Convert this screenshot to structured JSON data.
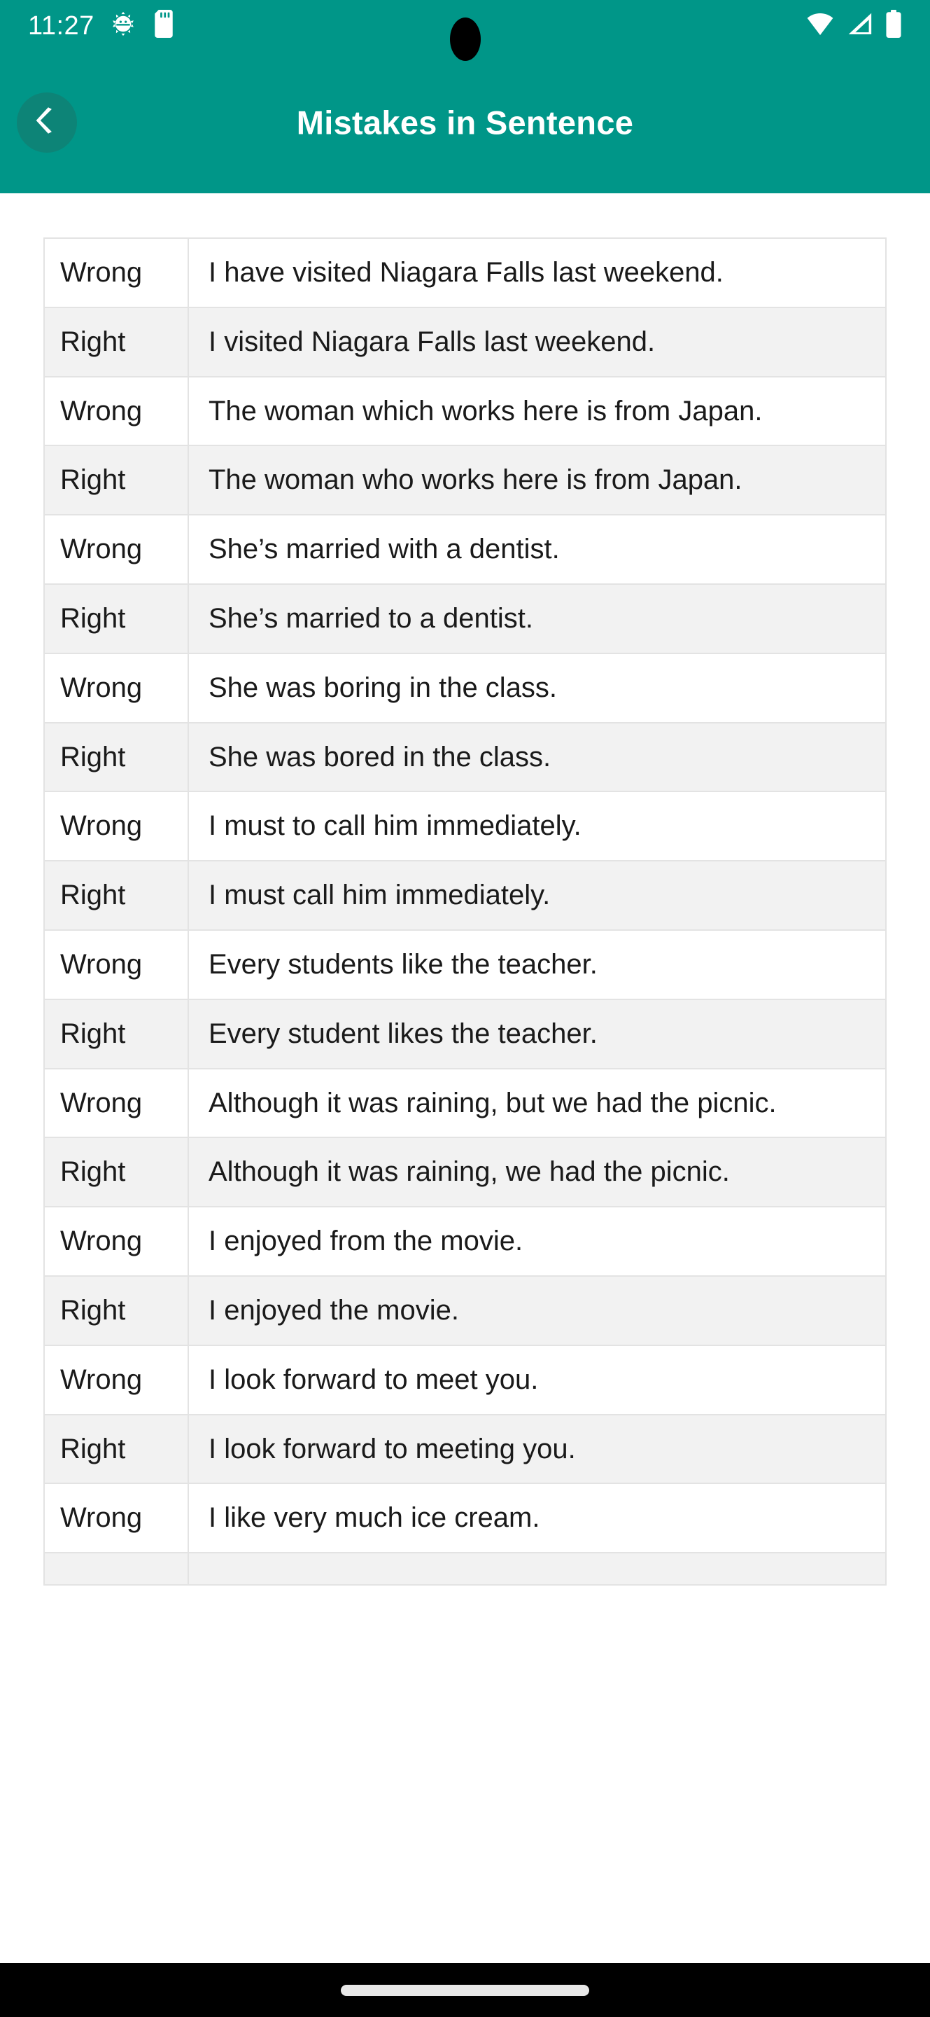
{
  "status_bar": {
    "time": "11:27",
    "icons_left": [
      "android-debug-icon",
      "sd-card-icon"
    ],
    "icons_right": [
      "wifi-icon",
      "cellular-signal-icon",
      "battery-icon"
    ],
    "background_color": "#009688"
  },
  "app_bar": {
    "title": "Mistakes in Sentence",
    "back_icon": "chevron-left-icon",
    "background_color": "#009688",
    "back_button_color": "#0d8477",
    "title_color": "#ffffff"
  },
  "table": {
    "row_colors": {
      "odd": "#ffffff",
      "even": "#f2f2f2"
    },
    "border_color": "#e3e3e3",
    "rows": [
      {
        "label": "Wrong",
        "sentence": "I have visited Niagara Falls last weekend."
      },
      {
        "label": "Right",
        "sentence": "I visited Niagara Falls last weekend."
      },
      {
        "label": "Wrong",
        "sentence": "The woman which works here is from Japan."
      },
      {
        "label": "Right",
        "sentence": "The woman who works here is from Japan."
      },
      {
        "label": "Wrong",
        "sentence": "She’s married with a dentist."
      },
      {
        "label": "Right",
        "sentence": "She’s married to a dentist."
      },
      {
        "label": "Wrong",
        "sentence": "She was boring in the class."
      },
      {
        "label": "Right",
        "sentence": "She was bored in the class."
      },
      {
        "label": "Wrong",
        "sentence": "I must to call him immediately."
      },
      {
        "label": "Right",
        "sentence": "I must call him immediately."
      },
      {
        "label": "Wrong",
        "sentence": "Every students like the teacher."
      },
      {
        "label": "Right",
        "sentence": "Every student likes the teacher."
      },
      {
        "label": "Wrong",
        "sentence": "Although it was raining, but we had the picnic."
      },
      {
        "label": "Right",
        "sentence": "Although it was raining, we had the picnic."
      },
      {
        "label": "Wrong",
        "sentence": "I enjoyed from the movie."
      },
      {
        "label": "Right",
        "sentence": "I enjoyed the movie."
      },
      {
        "label": "Wrong",
        "sentence": "I look forward to meet you."
      },
      {
        "label": "Right",
        "sentence": "I look forward to meeting you."
      },
      {
        "label": "Wrong",
        "sentence": "I like very much ice cream."
      },
      {
        "label": "",
        "sentence": ""
      }
    ]
  },
  "nav_bar": {
    "gesture_pill": "home-gesture-pill",
    "background_color": "#000000"
  }
}
